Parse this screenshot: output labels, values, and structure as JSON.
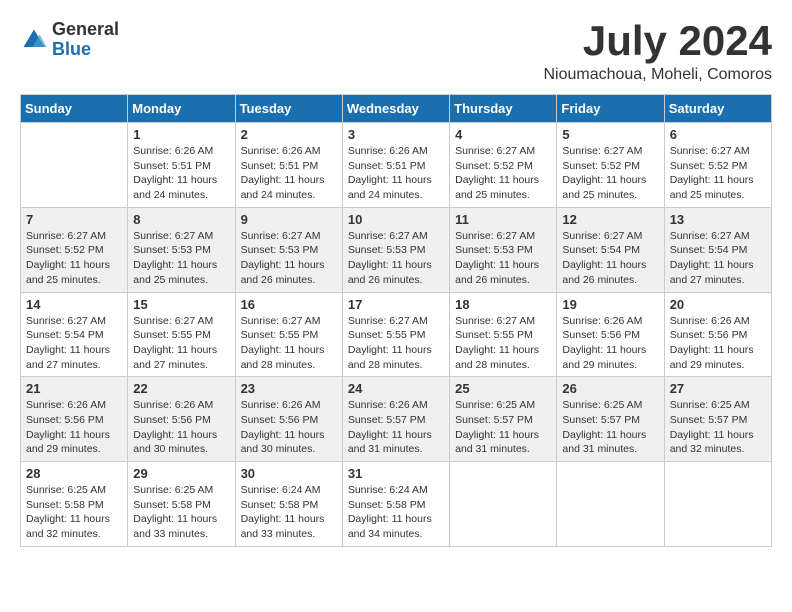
{
  "logo": {
    "general": "General",
    "blue": "Blue"
  },
  "title": {
    "month_year": "July 2024",
    "location": "Nioumachoua, Moheli, Comoros"
  },
  "weekdays": [
    "Sunday",
    "Monday",
    "Tuesday",
    "Wednesday",
    "Thursday",
    "Friday",
    "Saturday"
  ],
  "weeks": [
    [
      {
        "day": "",
        "info": ""
      },
      {
        "day": "1",
        "info": "Sunrise: 6:26 AM\nSunset: 5:51 PM\nDaylight: 11 hours\nand 24 minutes."
      },
      {
        "day": "2",
        "info": "Sunrise: 6:26 AM\nSunset: 5:51 PM\nDaylight: 11 hours\nand 24 minutes."
      },
      {
        "day": "3",
        "info": "Sunrise: 6:26 AM\nSunset: 5:51 PM\nDaylight: 11 hours\nand 24 minutes."
      },
      {
        "day": "4",
        "info": "Sunrise: 6:27 AM\nSunset: 5:52 PM\nDaylight: 11 hours\nand 25 minutes."
      },
      {
        "day": "5",
        "info": "Sunrise: 6:27 AM\nSunset: 5:52 PM\nDaylight: 11 hours\nand 25 minutes."
      },
      {
        "day": "6",
        "info": "Sunrise: 6:27 AM\nSunset: 5:52 PM\nDaylight: 11 hours\nand 25 minutes."
      }
    ],
    [
      {
        "day": "7",
        "info": "Sunrise: 6:27 AM\nSunset: 5:52 PM\nDaylight: 11 hours\nand 25 minutes."
      },
      {
        "day": "8",
        "info": "Sunrise: 6:27 AM\nSunset: 5:53 PM\nDaylight: 11 hours\nand 25 minutes."
      },
      {
        "day": "9",
        "info": "Sunrise: 6:27 AM\nSunset: 5:53 PM\nDaylight: 11 hours\nand 26 minutes."
      },
      {
        "day": "10",
        "info": "Sunrise: 6:27 AM\nSunset: 5:53 PM\nDaylight: 11 hours\nand 26 minutes."
      },
      {
        "day": "11",
        "info": "Sunrise: 6:27 AM\nSunset: 5:53 PM\nDaylight: 11 hours\nand 26 minutes."
      },
      {
        "day": "12",
        "info": "Sunrise: 6:27 AM\nSunset: 5:54 PM\nDaylight: 11 hours\nand 26 minutes."
      },
      {
        "day": "13",
        "info": "Sunrise: 6:27 AM\nSunset: 5:54 PM\nDaylight: 11 hours\nand 27 minutes."
      }
    ],
    [
      {
        "day": "14",
        "info": "Sunrise: 6:27 AM\nSunset: 5:54 PM\nDaylight: 11 hours\nand 27 minutes."
      },
      {
        "day": "15",
        "info": "Sunrise: 6:27 AM\nSunset: 5:55 PM\nDaylight: 11 hours\nand 27 minutes."
      },
      {
        "day": "16",
        "info": "Sunrise: 6:27 AM\nSunset: 5:55 PM\nDaylight: 11 hours\nand 28 minutes."
      },
      {
        "day": "17",
        "info": "Sunrise: 6:27 AM\nSunset: 5:55 PM\nDaylight: 11 hours\nand 28 minutes."
      },
      {
        "day": "18",
        "info": "Sunrise: 6:27 AM\nSunset: 5:55 PM\nDaylight: 11 hours\nand 28 minutes."
      },
      {
        "day": "19",
        "info": "Sunrise: 6:26 AM\nSunset: 5:56 PM\nDaylight: 11 hours\nand 29 minutes."
      },
      {
        "day": "20",
        "info": "Sunrise: 6:26 AM\nSunset: 5:56 PM\nDaylight: 11 hours\nand 29 minutes."
      }
    ],
    [
      {
        "day": "21",
        "info": "Sunrise: 6:26 AM\nSunset: 5:56 PM\nDaylight: 11 hours\nand 29 minutes."
      },
      {
        "day": "22",
        "info": "Sunrise: 6:26 AM\nSunset: 5:56 PM\nDaylight: 11 hours\nand 30 minutes."
      },
      {
        "day": "23",
        "info": "Sunrise: 6:26 AM\nSunset: 5:56 PM\nDaylight: 11 hours\nand 30 minutes."
      },
      {
        "day": "24",
        "info": "Sunrise: 6:26 AM\nSunset: 5:57 PM\nDaylight: 11 hours\nand 31 minutes."
      },
      {
        "day": "25",
        "info": "Sunrise: 6:25 AM\nSunset: 5:57 PM\nDaylight: 11 hours\nand 31 minutes."
      },
      {
        "day": "26",
        "info": "Sunrise: 6:25 AM\nSunset: 5:57 PM\nDaylight: 11 hours\nand 31 minutes."
      },
      {
        "day": "27",
        "info": "Sunrise: 6:25 AM\nSunset: 5:57 PM\nDaylight: 11 hours\nand 32 minutes."
      }
    ],
    [
      {
        "day": "28",
        "info": "Sunrise: 6:25 AM\nSunset: 5:58 PM\nDaylight: 11 hours\nand 32 minutes."
      },
      {
        "day": "29",
        "info": "Sunrise: 6:25 AM\nSunset: 5:58 PM\nDaylight: 11 hours\nand 33 minutes."
      },
      {
        "day": "30",
        "info": "Sunrise: 6:24 AM\nSunset: 5:58 PM\nDaylight: 11 hours\nand 33 minutes."
      },
      {
        "day": "31",
        "info": "Sunrise: 6:24 AM\nSunset: 5:58 PM\nDaylight: 11 hours\nand 34 minutes."
      },
      {
        "day": "",
        "info": ""
      },
      {
        "day": "",
        "info": ""
      },
      {
        "day": "",
        "info": ""
      }
    ]
  ]
}
